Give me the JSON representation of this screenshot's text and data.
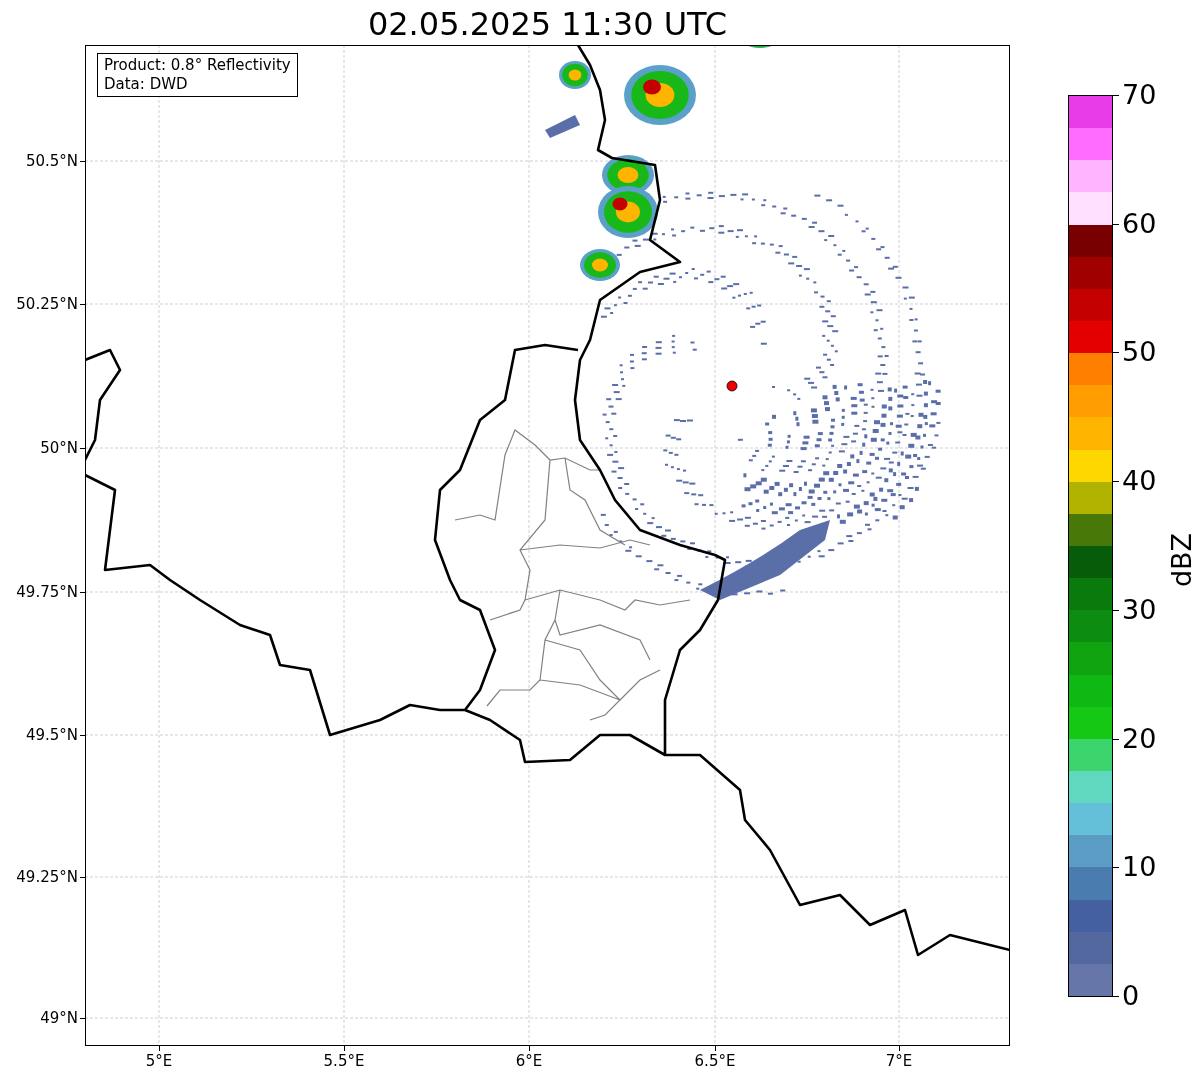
{
  "title": "02.05.2025 11:30 UTC",
  "legend": [
    "Product: 0.8° Reflectivity",
    "Data: DWD"
  ],
  "map": {
    "kind": "map",
    "yticks": [
      "50.5°N",
      "50.25°N",
      "50°N",
      "49.75°N",
      "49.5°N",
      "49.25°N",
      "49°N"
    ],
    "xticks": [
      "5°E",
      "5.5°E",
      "6°E",
      "6.5°E",
      "7°E"
    ]
  },
  "colorbar": {
    "label": "dBZ",
    "ticks": [
      "70",
      "60",
      "50",
      "40",
      "30",
      "20",
      "10",
      "0"
    ],
    "segments": [
      {
        "color": "#e83ce8"
      },
      {
        "color": "#ff6cff"
      },
      {
        "color": "#ffb4ff"
      },
      {
        "color": "#ffe0ff"
      },
      {
        "color": "#780000"
      },
      {
        "color": "#a00000"
      },
      {
        "color": "#c40000"
      },
      {
        "color": "#e40000"
      },
      {
        "color": "#ff8000"
      },
      {
        "color": "#ff9c00"
      },
      {
        "color": "#ffb400"
      },
      {
        "color": "#ffd700"
      },
      {
        "color": "#b0b400"
      },
      {
        "color": "#487808"
      },
      {
        "color": "#065c08"
      },
      {
        "color": "#0a7a0c"
      },
      {
        "color": "#0c8c10"
      },
      {
        "color": "#10a410"
      },
      {
        "color": "#10b814"
      },
      {
        "color": "#14c814"
      },
      {
        "color": "#3cd46c"
      },
      {
        "color": "#60d8c0"
      },
      {
        "color": "#64c0d8"
      },
      {
        "color": "#5a9cc4"
      },
      {
        "color": "#4a7cb0"
      },
      {
        "color": "#4560a0"
      },
      {
        "color": "#5468a0"
      },
      {
        "color": "#6676a8"
      }
    ]
  }
}
